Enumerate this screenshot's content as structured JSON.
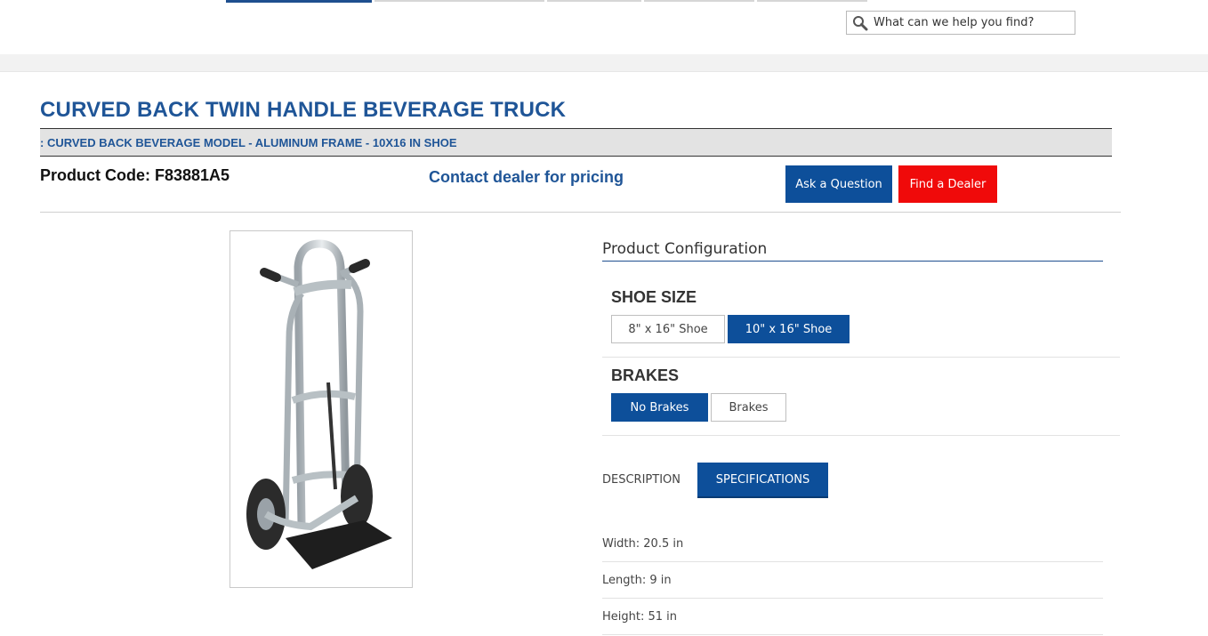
{
  "search": {
    "placeholder": "What can we help you find?"
  },
  "product": {
    "title": "CURVED BACK TWIN HANDLE BEVERAGE TRUCK",
    "subtitle": ": CURVED BACK BEVERAGE MODEL - ALUMINUM FRAME - 10X16 IN SHOE",
    "code": "Product Code: F83881A5",
    "pricing": "Contact dealer for pricing"
  },
  "actions": {
    "ask_label": "Ask a Question",
    "dealer_label": "Find a Dealer"
  },
  "config": {
    "title": "Product Configuration",
    "shoe_size": {
      "label": "SHOE SIZE",
      "options": [
        "8\" x 16\" Shoe",
        "10\" x 16\" Shoe"
      ],
      "selected": "10\" x 16\" Shoe"
    },
    "brakes": {
      "label": "BRAKES",
      "options": [
        "No Brakes",
        "Brakes"
      ],
      "selected": "No Brakes"
    }
  },
  "tabs": {
    "description": "DESCRIPTION",
    "specifications": "SPECIFICATIONS",
    "active": "SPECIFICATIONS"
  },
  "specs": [
    "Width: 20.5 in",
    "Length: 9 in",
    "Height: 51 in"
  ],
  "colors": {
    "brand_blue": "#0d4f9a",
    "title_blue": "#1f5597",
    "dealer_red": "#f00a0a"
  }
}
